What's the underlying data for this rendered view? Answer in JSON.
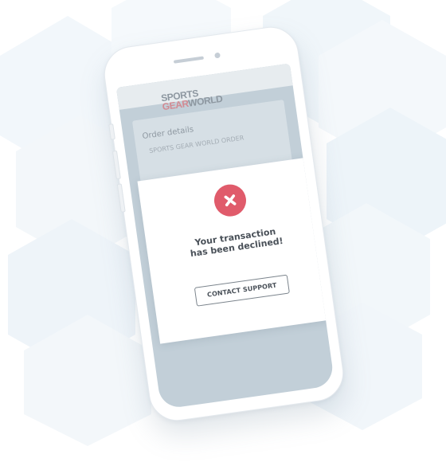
{
  "app": {
    "brand_line1": "SPORTS",
    "brand_line2_accent": "GEAR",
    "brand_line2_rest": "WORLD",
    "order_title": "Order details",
    "order_line": "SPORTS GEAR WORLD ORDER"
  },
  "modal": {
    "icon": "close-icon",
    "message_line1": "Your transaction",
    "message_line2": "has been declined!",
    "button_label": "CONTACT SUPPORT"
  },
  "colors": {
    "decline_accent": "#e05b6b",
    "brand_accent": "#d28a92",
    "screen_overlay": "#c2cfd8"
  }
}
